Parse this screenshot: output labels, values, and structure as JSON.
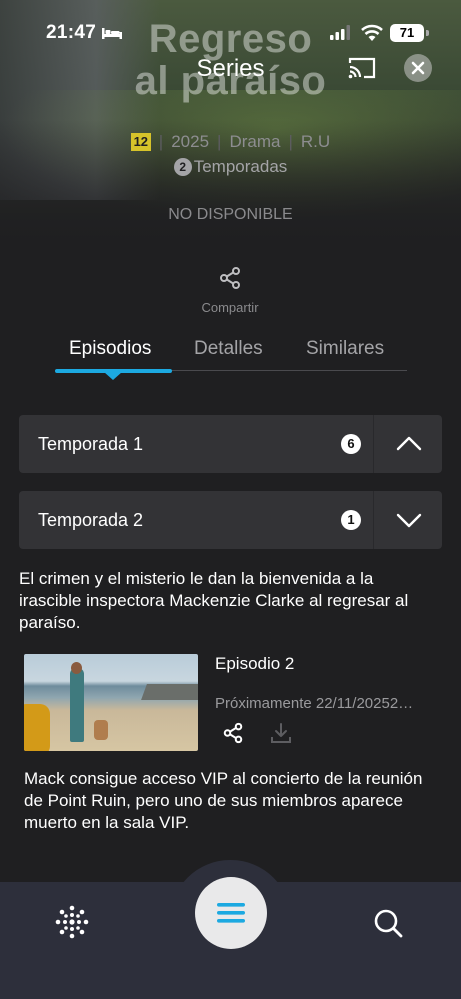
{
  "status_bar": {
    "time": "21:47",
    "battery": "71"
  },
  "hero": {
    "title_art_line1": "Regreso",
    "title_art_line2": "al paraíso",
    "header_title": "Series",
    "age_rating": "12",
    "year": "2025",
    "genre": "Drama",
    "country": "R.U",
    "seasons_count": "2",
    "seasons_label": "Temporadas",
    "availability": "NO DISPONIBLE"
  },
  "share": {
    "label": "Compartir"
  },
  "tabs": [
    {
      "label": "Episodios"
    },
    {
      "label": "Detalles"
    },
    {
      "label": "Similares"
    }
  ],
  "seasons": [
    {
      "label": "Temporada 1",
      "count": "6"
    },
    {
      "label": "Temporada 2",
      "count": "1"
    }
  ],
  "season_description": "El crimen y el misterio le dan la bienvenida a la irascible inspectora Mackenzie Clarke al regresar al paraíso.",
  "episode": {
    "title": "Episodio 2",
    "date": "Próximamente 22/11/20252…",
    "description": "Mack consigue acceso VIP al concierto de la reunión de Point Ruin, pero uno de sus miembros aparece muerto en la sala VIP."
  },
  "icons": {
    "cast": "cast-icon",
    "close": "close-icon",
    "share": "share-icon",
    "download": "download-icon",
    "home": "home-dots-icon",
    "menu": "menu-icon",
    "search": "search-icon"
  },
  "colors": {
    "accent": "#1ca9e1",
    "background": "#1f1f21",
    "card": "#333336",
    "nav": "#2d2f3b",
    "age_badge": "#d6c32a"
  }
}
